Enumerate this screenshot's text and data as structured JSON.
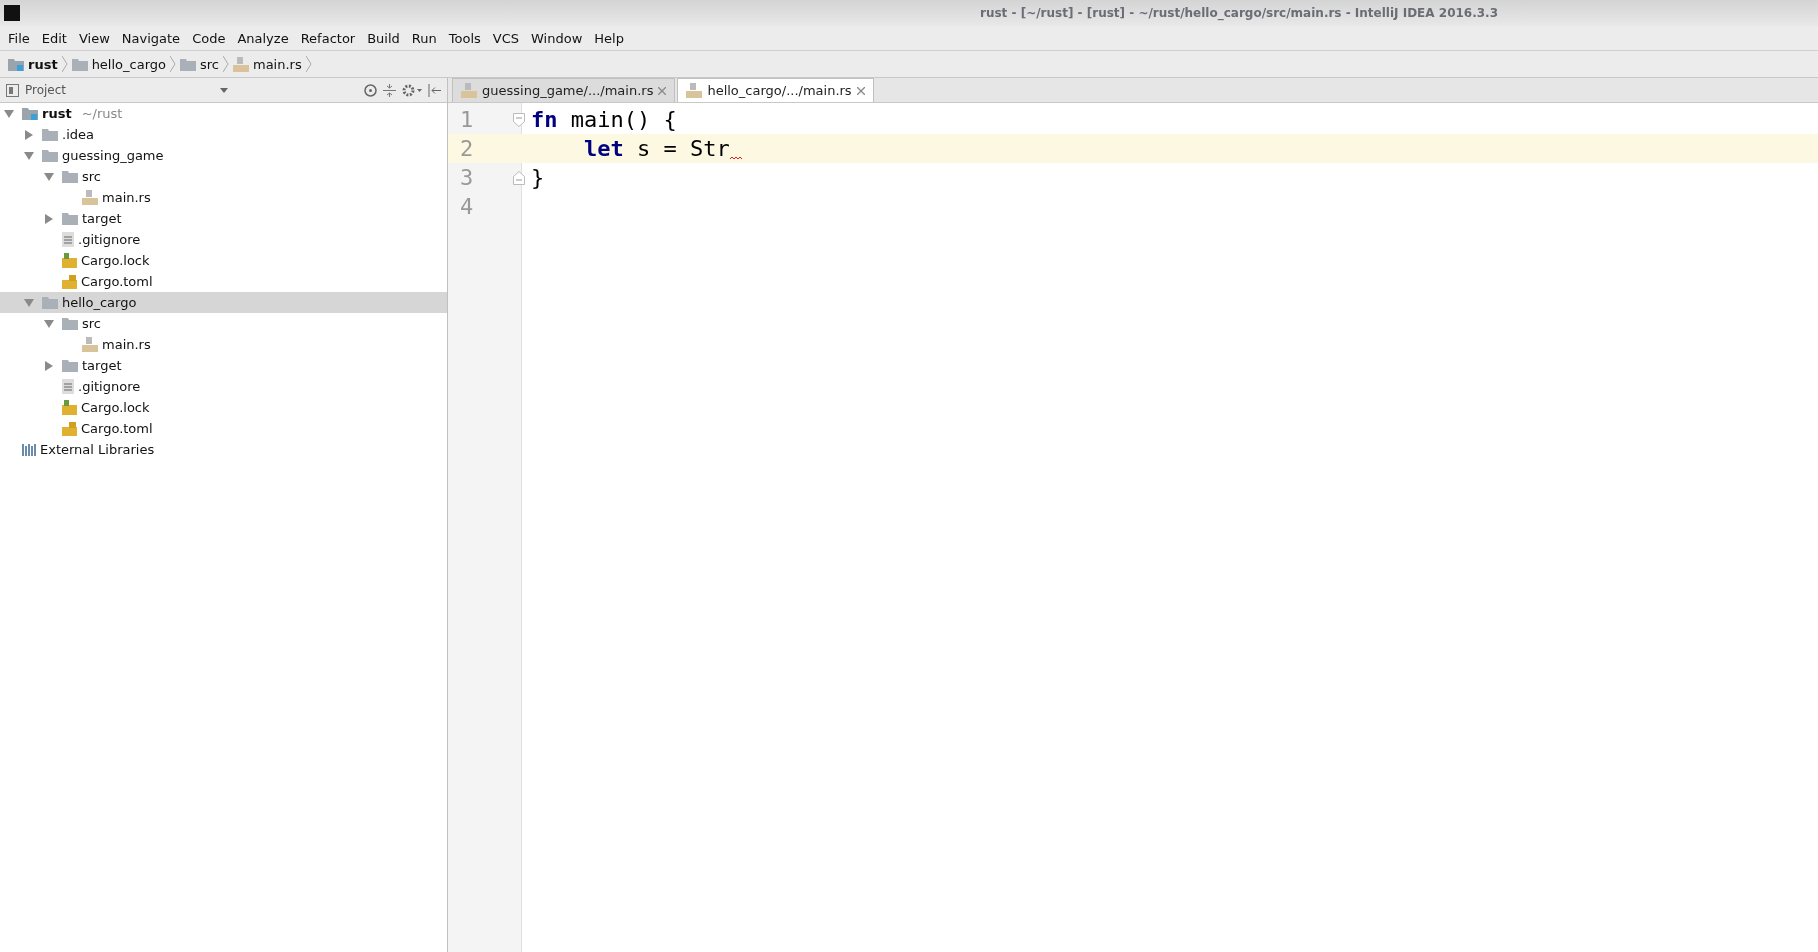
{
  "window": {
    "title": "rust - [~/rust] - [rust] - ~/rust/hello_cargo/src/main.rs - IntelliJ IDEA 2016.3.3"
  },
  "menu": [
    "File",
    "Edit",
    "View",
    "Navigate",
    "Code",
    "Analyze",
    "Refactor",
    "Build",
    "Run",
    "Tools",
    "VCS",
    "Window",
    "Help"
  ],
  "breadcrumbs": [
    {
      "label": "rust",
      "kind": "project"
    },
    {
      "label": "hello_cargo",
      "kind": "folder"
    },
    {
      "label": "src",
      "kind": "folder"
    },
    {
      "label": "main.rs",
      "kind": "rust-file"
    }
  ],
  "project_panel": {
    "title": "Project",
    "tree": [
      {
        "label": "rust",
        "hint": "~/rust",
        "kind": "project",
        "expanded": true,
        "selected": false,
        "children": [
          {
            "label": ".idea",
            "kind": "folder",
            "expanded": false,
            "selected": false
          },
          {
            "label": "guessing_game",
            "kind": "folder",
            "expanded": true,
            "selected": false,
            "children": [
              {
                "label": "src",
                "kind": "folder",
                "expanded": true,
                "selected": false,
                "children": [
                  {
                    "label": "main.rs",
                    "kind": "rust-file",
                    "selected": false
                  }
                ]
              },
              {
                "label": "target",
                "kind": "folder",
                "expanded": false,
                "selected": false
              },
              {
                "label": ".gitignore",
                "kind": "text-file",
                "selected": false
              },
              {
                "label": "Cargo.lock",
                "kind": "lock-file",
                "selected": false
              },
              {
                "label": "Cargo.toml",
                "kind": "toml-file",
                "selected": false
              }
            ]
          },
          {
            "label": "hello_cargo",
            "kind": "folder",
            "expanded": true,
            "selected": true,
            "children": [
              {
                "label": "src",
                "kind": "folder",
                "expanded": true,
                "selected": false,
                "children": [
                  {
                    "label": "main.rs",
                    "kind": "rust-file",
                    "selected": false
                  }
                ]
              },
              {
                "label": "target",
                "kind": "folder",
                "expanded": false,
                "selected": false
              },
              {
                "label": ".gitignore",
                "kind": "text-file",
                "selected": false
              },
              {
                "label": "Cargo.lock",
                "kind": "lock-file",
                "selected": false
              },
              {
                "label": "Cargo.toml",
                "kind": "toml-file",
                "selected": false
              }
            ]
          }
        ]
      },
      {
        "label": "External Libraries",
        "kind": "library",
        "selected": false
      }
    ]
  },
  "tabs": [
    {
      "label": "guessing_game/.../main.rs",
      "selected": false
    },
    {
      "label": "hello_cargo/.../main.rs",
      "selected": true
    }
  ],
  "editor": {
    "lines": [
      {
        "number": "1",
        "current": false,
        "fold_start": true,
        "fold_end": false,
        "indented": false,
        "error": false,
        "tokens": [
          {
            "text": "fn",
            "kind": "keyword"
          },
          {
            "text": " main() {",
            "kind": "plain"
          }
        ]
      },
      {
        "number": "2",
        "current": true,
        "fold_start": false,
        "fold_end": false,
        "indented": true,
        "error": true,
        "tokens": [
          {
            "text": "let",
            "kind": "keyword"
          },
          {
            "text": " s = Str",
            "kind": "plain"
          }
        ]
      },
      {
        "number": "3",
        "current": false,
        "fold_start": false,
        "fold_end": true,
        "indented": false,
        "error": false,
        "tokens": [
          {
            "text": "}",
            "kind": "plain"
          }
        ]
      },
      {
        "number": "4",
        "current": false,
        "fold_start": false,
        "fold_end": false,
        "error": false
      }
    ]
  }
}
